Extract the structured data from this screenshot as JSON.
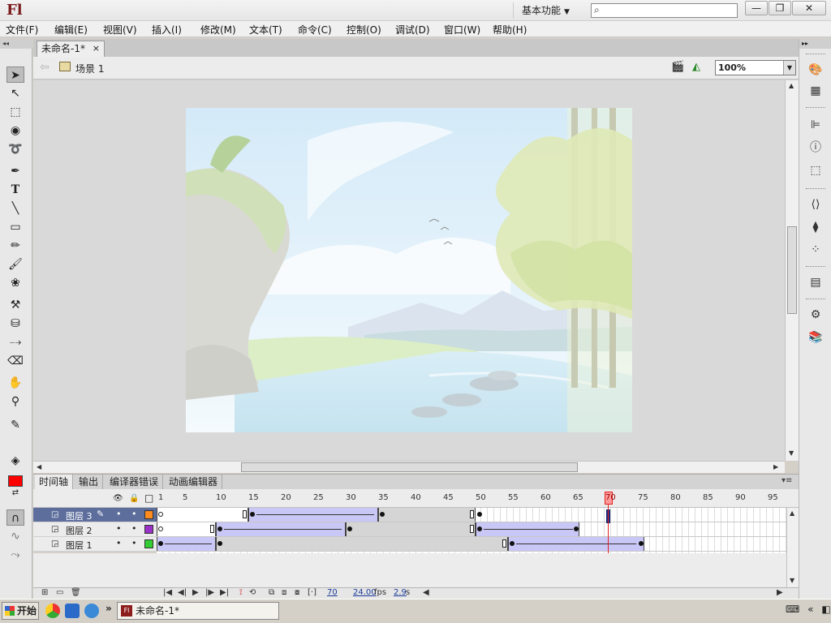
{
  "app": {
    "logo": "Fl",
    "workspace": "基本功能",
    "search_placeholder": ""
  },
  "window_controls": {
    "minimize": "—",
    "restore": "❐",
    "close": "✕"
  },
  "menu": [
    "文件(F)",
    "编辑(E)",
    "视图(V)",
    "插入(I)",
    "修改(M)",
    "文本(T)",
    "命令(C)",
    "控制(O)",
    "调试(D)",
    "窗口(W)",
    "帮助(H)"
  ],
  "document": {
    "tab_title": "未命名-1*",
    "tab_close": "×",
    "scene": "场景 1",
    "zoom": "100%"
  },
  "timeline": {
    "tabs": [
      "时间轴",
      "输出",
      "编译器错误",
      "动画编辑器"
    ],
    "frame_labels": [
      "1",
      "5",
      "10",
      "15",
      "20",
      "25",
      "30",
      "35",
      "40",
      "45",
      "50",
      "55",
      "60",
      "65",
      "70",
      "75",
      "80",
      "85",
      "90",
      "95"
    ],
    "current_frame": 70,
    "layers": [
      {
        "name": "图层 3",
        "color": "#ff8a1e",
        "selected": true
      },
      {
        "name": "图层 2",
        "color": "#9b30c8",
        "selected": false
      },
      {
        "name": "图层 1",
        "color": "#33cc33",
        "selected": false
      }
    ],
    "footer": {
      "frame": "70",
      "fps": "24.00",
      "fps_unit": "fps",
      "time": "2.9",
      "time_unit": "s"
    }
  },
  "colors": {
    "stroke": "#ff0000",
    "fill": "#b9b9b9"
  },
  "taskbar": {
    "start": "开始",
    "task": "未命名-1*",
    "chevron": "»"
  }
}
